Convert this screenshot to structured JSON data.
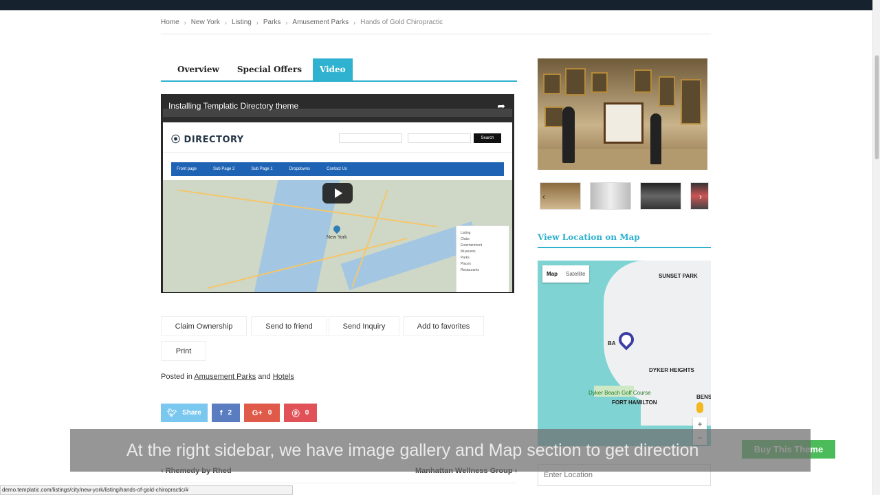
{
  "breadcrumb": {
    "items": [
      "Home",
      "New York",
      "Listing",
      "Parks",
      "Amusement Parks"
    ],
    "current": "Hands of Gold Chiropractic"
  },
  "tabs": [
    {
      "label": "Overview",
      "active": false
    },
    {
      "label": "Special Offers",
      "active": false
    },
    {
      "label": "Video",
      "active": true
    }
  ],
  "video": {
    "title": "Installing Templatic Directory theme",
    "site_logo": "DIRECTORY",
    "search_label": "Search",
    "nav_items": [
      "Front page",
      "Sub Page 2",
      "Sub Page 1",
      "Dropdowns",
      "Contact Us"
    ],
    "map_pin_label": "New York",
    "panel_items": [
      "Listing",
      "Clubs",
      "Entertainment",
      "Museums",
      "Parks",
      "Places",
      "Restaurants"
    ]
  },
  "actions": {
    "claim": "Claim Ownership",
    "send_friend": "Send to friend",
    "inquiry": "Send Inquiry",
    "favorites": "Add to favorites",
    "print": "Print"
  },
  "posted": {
    "prefix": "Posted in",
    "cat1": "Amusement Parks",
    "and": "and",
    "cat2": "Hotels"
  },
  "social": {
    "twitter_label": "Share",
    "facebook_count": "2",
    "gplus_count": "0",
    "pinterest_count": "0"
  },
  "nav_posts": {
    "prev": "Rhemedy by Rhed",
    "next": "Manhattan Wellness Group"
  },
  "sidebar": {
    "map_heading": "View Location on Map",
    "map_toggle": {
      "map": "Map",
      "satellite": "Satellite"
    },
    "map_labels": {
      "sunset_park": "SUNSET PARK",
      "bay_ridge": "BA",
      "dyker_heights": "DYKER HEIGHTS",
      "golf": "Dyker Beach Golf Course",
      "fort_hamilton": "FORT HAMILTON",
      "bens": "BENS"
    },
    "location_placeholder": "Enter Location"
  },
  "caption": "At the right sidebar, we have image gallery and Map section to get direction",
  "buy_button": "Buy This Theme",
  "status_url": "demo.templatic.com/listings/city/new-york/listing/hands-of-gold-chiropractic/#",
  "colors": {
    "accent": "#2fb2cf",
    "twitter": "#7ac8f0",
    "facebook": "#5a7cc0",
    "gplus": "#e05a4a",
    "pinterest": "#e05257",
    "buy": "#4cbb5a"
  }
}
